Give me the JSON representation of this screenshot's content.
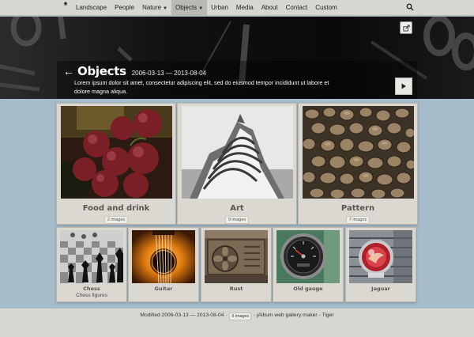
{
  "nav": {
    "items": [
      {
        "label": "Landscape"
      },
      {
        "label": "People"
      },
      {
        "label": "Nature",
        "dropdown": true
      },
      {
        "label": "Objects",
        "dropdown": true,
        "active": true
      },
      {
        "label": "Urban"
      },
      {
        "label": "Media"
      },
      {
        "label": "About"
      },
      {
        "label": "Contact"
      },
      {
        "label": "Custom"
      }
    ]
  },
  "hero": {
    "title": "Objects",
    "dates": "2006-03-13 — 2013-08-04",
    "description": "Lorem ipsum dolor sit amet, consectetur adipiscing elit, sed do eiusmod tempor incididunt ut labore et dolore magna aliqua."
  },
  "folders": [
    {
      "title": "Food and drink",
      "badge": "2 images"
    },
    {
      "title": "Art",
      "badge": "9 images"
    },
    {
      "title": "Pattern",
      "badge": "7 images"
    }
  ],
  "images": [
    {
      "title": "Chess",
      "subtitle": "Chess figures"
    },
    {
      "title": "Guitar",
      "subtitle": ""
    },
    {
      "title": "Rust",
      "subtitle": ""
    },
    {
      "title": "Old gauge",
      "subtitle": ""
    },
    {
      "title": "Jaguar",
      "subtitle": ""
    }
  ],
  "footer": {
    "modified_prefix": "Modified",
    "dates": "2006-03-13 — 2013-08-04",
    "sep1": "·",
    "badge": "5 images",
    "sep2": "·",
    "credit": "jAlbum web gallery maker",
    "sep3": "-",
    "skin": "Tiger"
  },
  "colors": {
    "background": "#a7bccb",
    "nav_bg": "#d7d6d2",
    "card_bg": "#dad8d0",
    "hero_bg": "#050505"
  }
}
